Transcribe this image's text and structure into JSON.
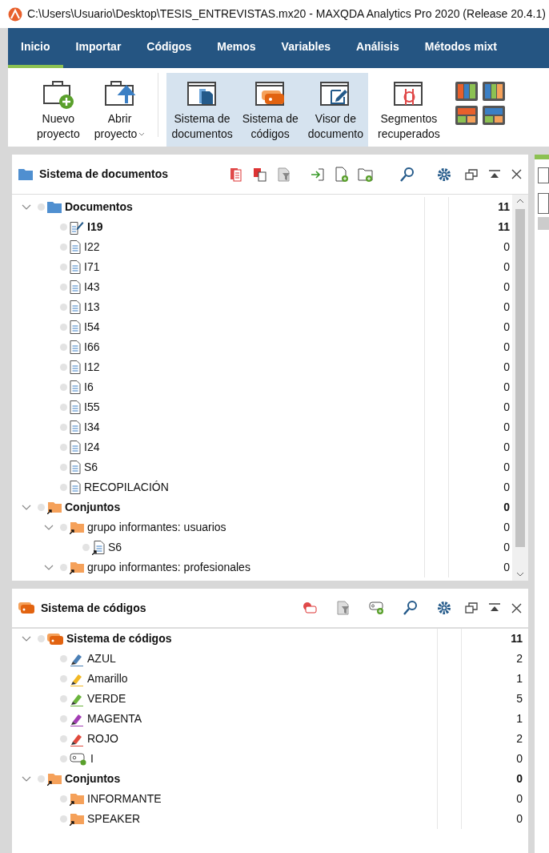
{
  "window": {
    "title": "C:\\Users\\Usuario\\Desktop\\TESIS_ENTREVISTAS.mx20 - MAXQDA Analytics Pro 2020 (Release 20.4.1)"
  },
  "ribbon_tabs": [
    {
      "label": "Inicio",
      "selected": true
    },
    {
      "label": "Importar",
      "selected": false
    },
    {
      "label": "Códigos",
      "selected": false
    },
    {
      "label": "Memos",
      "selected": false
    },
    {
      "label": "Variables",
      "selected": false
    },
    {
      "label": "Análisis",
      "selected": false
    },
    {
      "label": "Métodos mixt",
      "selected": false
    }
  ],
  "toolbar": [
    {
      "kind": "new",
      "label": "Nuevo\nproyecto",
      "on": false,
      "dropdown": false
    },
    {
      "kind": "open",
      "label": "Abrir\nproyecto",
      "on": false,
      "dropdown": true
    },
    {
      "kind": "docs",
      "label": "Sistema de\ndocumentos",
      "on": true,
      "dropdown": false
    },
    {
      "kind": "codes",
      "label": "Sistema de\ncódigos",
      "on": true,
      "dropdown": false
    },
    {
      "kind": "viewer",
      "label": "Visor de\ndocumento",
      "on": true,
      "dropdown": false
    },
    {
      "kind": "segments",
      "label": "Segmentos\nrecuperados",
      "on": false,
      "dropdown": false
    }
  ],
  "document_panel": {
    "title": "Sistema de documentos",
    "tree": [
      {
        "kind": "folder",
        "label": "Documentos",
        "count": "11",
        "expanded": true,
        "children": [
          {
            "kind": "doc-edit",
            "label": "I19",
            "count": "11",
            "active": true
          },
          {
            "kind": "doc",
            "label": "I22",
            "count": "0",
            "active": false
          },
          {
            "kind": "doc",
            "label": "I71",
            "count": "0",
            "active": false
          },
          {
            "kind": "doc",
            "label": "I43",
            "count": "0",
            "active": false
          },
          {
            "kind": "doc",
            "label": "I13",
            "count": "0",
            "active": false
          },
          {
            "kind": "doc",
            "label": "I54",
            "count": "0",
            "active": false
          },
          {
            "kind": "doc",
            "label": "I66",
            "count": "0",
            "active": false
          },
          {
            "kind": "doc",
            "label": "I12",
            "count": "0",
            "active": false
          },
          {
            "kind": "doc",
            "label": "I6",
            "count": "0",
            "active": false
          },
          {
            "kind": "doc",
            "label": "I55",
            "count": "0",
            "active": false
          },
          {
            "kind": "doc",
            "label": "I34",
            "count": "0",
            "active": false
          },
          {
            "kind": "doc",
            "label": "I24",
            "count": "0",
            "active": false
          },
          {
            "kind": "doc",
            "label": "S6",
            "count": "0",
            "active": false
          },
          {
            "kind": "doc",
            "label": "RECOPILACIÓN",
            "count": "0",
            "active": false
          }
        ]
      },
      {
        "kind": "set",
        "label": "Conjuntos",
        "count": "0",
        "expanded": true,
        "children": [
          {
            "kind": "set",
            "label": "grupo informantes: usuarios",
            "count": "0",
            "expanded": true,
            "children": [
              {
                "kind": "doc-link",
                "label": "S6",
                "count": "0",
                "active": false
              }
            ]
          },
          {
            "kind": "set",
            "label": "grupo informantes: profesionales",
            "count": "0",
            "expanded": true
          }
        ]
      }
    ]
  },
  "code_panel": {
    "title": "Sistema de códigos",
    "tree": [
      {
        "kind": "code-root",
        "label": "Sistema de códigos",
        "count": "11",
        "expanded": true,
        "children": [
          {
            "kind": "code",
            "label": "AZUL",
            "count": "2",
            "color": "#4a7fb5"
          },
          {
            "kind": "code",
            "label": "Amarillo",
            "count": "1",
            "color": "#f2b824"
          },
          {
            "kind": "code",
            "label": "VERDE",
            "count": "5",
            "color": "#6ab43c"
          },
          {
            "kind": "code",
            "label": "MAGENTA",
            "count": "1",
            "color": "#a23cb4"
          },
          {
            "kind": "code",
            "label": "ROJO",
            "count": "2",
            "color": "#e0493c"
          },
          {
            "kind": "code-new",
            "label": "I",
            "count": "0"
          }
        ]
      },
      {
        "kind": "set",
        "label": "Conjuntos",
        "count": "0",
        "expanded": true,
        "children": [
          {
            "kind": "set",
            "label": "INFORMANTE",
            "count": "0"
          },
          {
            "kind": "set",
            "label": "SPEAKER",
            "count": "0"
          }
        ]
      }
    ]
  }
}
